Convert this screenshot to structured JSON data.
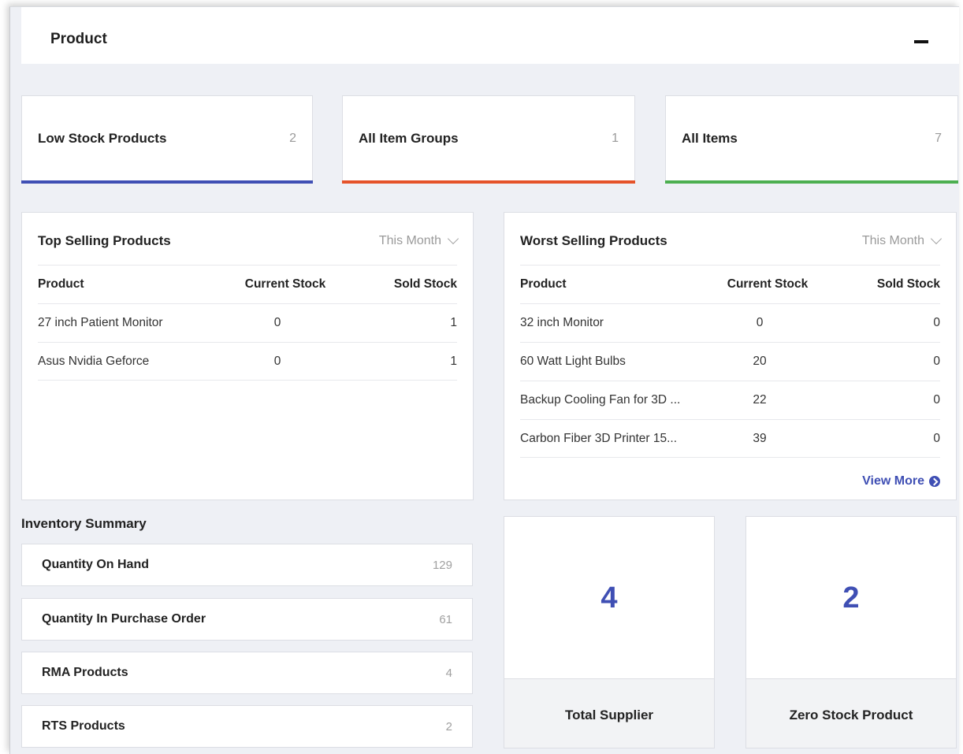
{
  "header": {
    "title": "Product",
    "collapse_icon": "minus-icon"
  },
  "stats": [
    {
      "label": "Low Stock Products",
      "count": "2",
      "color": "#3f4fb4"
    },
    {
      "label": "All Item Groups",
      "count": "1",
      "color": "#e5532a"
    },
    {
      "label": "All Items",
      "count": "7",
      "color": "#4caf50"
    }
  ],
  "top_selling": {
    "title": "Top Selling Products",
    "filter": "This Month",
    "columns": [
      "Product",
      "Current Stock",
      "Sold Stock"
    ],
    "rows": [
      {
        "product": "27 inch Patient Monitor",
        "current": "0",
        "sold": "1"
      },
      {
        "product": "Asus Nvidia Geforce",
        "current": "0",
        "sold": "1"
      }
    ]
  },
  "worst_selling": {
    "title": "Worst Selling Products",
    "filter": "This Month",
    "columns": [
      "Product",
      "Current Stock",
      "Sold Stock"
    ],
    "rows": [
      {
        "product": "32 inch Monitor",
        "current": "0",
        "sold": "0"
      },
      {
        "product": "60 Watt Light Bulbs",
        "current": "20",
        "sold": "0"
      },
      {
        "product": "Backup Cooling Fan for 3D ...",
        "current": "22",
        "sold": "0"
      },
      {
        "product": "Carbon Fiber 3D Printer 15...",
        "current": "39",
        "sold": "0"
      }
    ],
    "view_more": "View More"
  },
  "inventory": {
    "title": "Inventory Summary",
    "items": [
      {
        "label": "Quantity On Hand",
        "value": "129"
      },
      {
        "label": "Quantity In Purchase Order",
        "value": "61"
      },
      {
        "label": "RMA Products",
        "value": "4"
      },
      {
        "label": "RTS Products",
        "value": "2"
      }
    ]
  },
  "summary_cards": [
    {
      "value": "4",
      "label": "Total Supplier"
    },
    {
      "value": "2",
      "label": "Zero Stock Product"
    }
  ]
}
